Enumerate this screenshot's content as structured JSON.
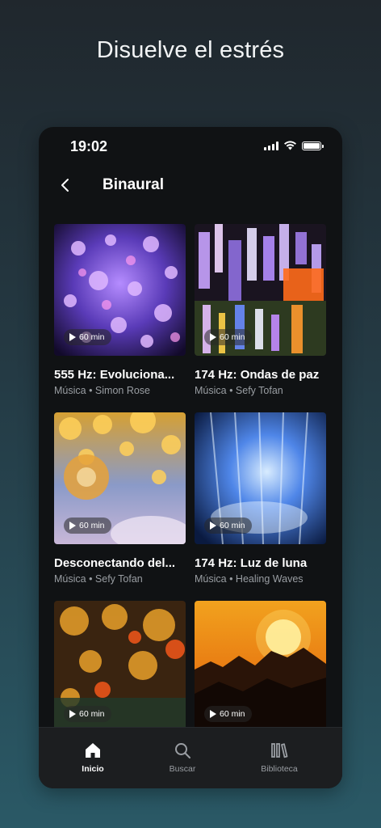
{
  "headline": "Disuelve el estrés",
  "status": {
    "time": "19:02",
    "battery_level": 1.0
  },
  "nav": {
    "title": "Binaural"
  },
  "cards": [
    {
      "title": "555 Hz: Evoluciona...",
      "subtitle": "Música • Simon Rose",
      "duration": "60 min"
    },
    {
      "title": "174 Hz: Ondas de paz",
      "subtitle": "Música • Sefy Tofan",
      "duration": "60 min"
    },
    {
      "title": "Desconectando del...",
      "subtitle": "Música • Sefy Tofan",
      "duration": "60 min"
    },
    {
      "title": "174 Hz: Luz de luna",
      "subtitle": "Música • Healing Waves",
      "duration": "60 min"
    },
    {
      "title": "",
      "subtitle": "",
      "duration": "60 min"
    },
    {
      "title": "",
      "subtitle": "",
      "duration": "60 min"
    }
  ],
  "tabs": [
    {
      "label": "Inicio",
      "icon": "home-icon",
      "active": true
    },
    {
      "label": "Buscar",
      "icon": "search-icon",
      "active": false
    },
    {
      "label": "Biblioteca",
      "icon": "library-icon",
      "active": false
    }
  ],
  "colors": {
    "background_top": "#20272d",
    "background_bottom": "#2a5966",
    "phone": "#101214",
    "muted_text": "#9a9ea3"
  }
}
